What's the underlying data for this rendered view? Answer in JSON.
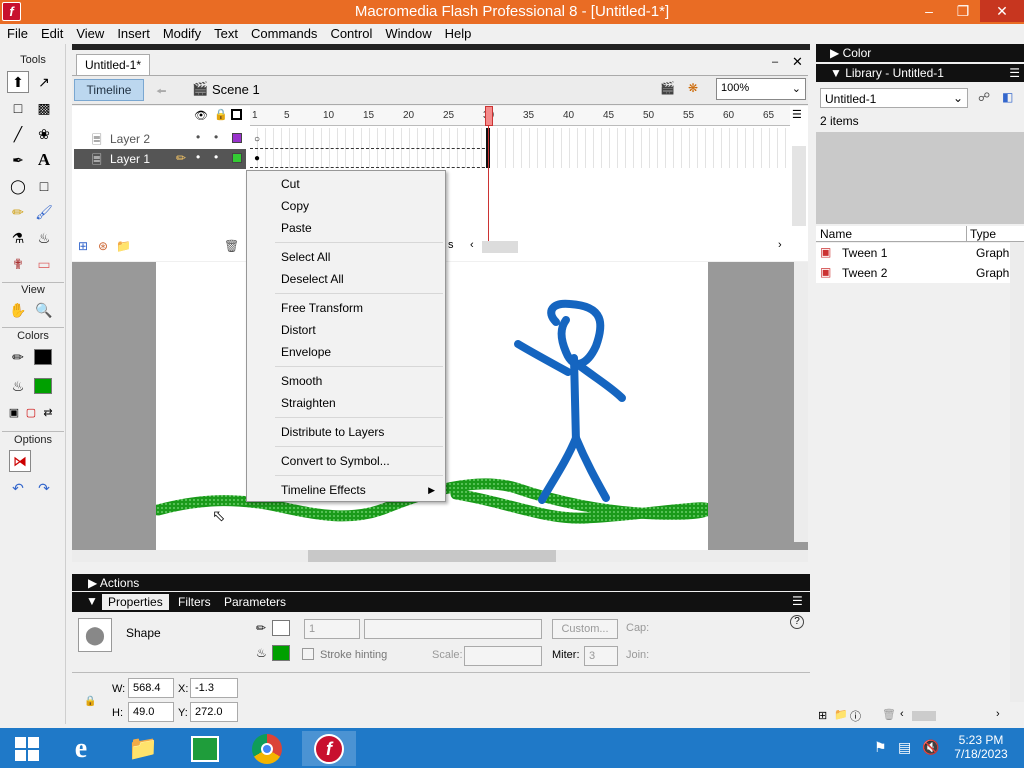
{
  "window": {
    "title": "Macromedia Flash Professional 8 - [Untitled-1*]"
  },
  "menu": [
    "File",
    "Edit",
    "View",
    "Insert",
    "Modify",
    "Text",
    "Commands",
    "Control",
    "Window",
    "Help"
  ],
  "tools": {
    "header": "Tools",
    "view": "View",
    "colors": "Colors",
    "options": "Options"
  },
  "document": {
    "tab": "Untitled-1*",
    "timeline_button": "Timeline",
    "scene": "Scene 1",
    "zoom": "100%"
  },
  "timeline": {
    "layers": [
      {
        "name": "Layer 2"
      },
      {
        "name": "Layer 1"
      }
    ],
    "ruler": [
      "1",
      "5",
      "10",
      "15",
      "20",
      "25",
      "30",
      "35",
      "40",
      "45",
      "50",
      "55",
      "60",
      "65"
    ],
    "current_frame": "30",
    "fps_fragment": "s"
  },
  "context_menu": {
    "items": [
      "Cut",
      "Copy",
      "Paste",
      "Select All",
      "Deselect All",
      "Free Transform",
      "Distort",
      "Envelope",
      "Smooth",
      "Straighten",
      "Distribute to Layers",
      "Convert to Symbol...",
      "Timeline Effects"
    ]
  },
  "actions_panel": {
    "title": "Actions"
  },
  "properties": {
    "tabs": [
      "Properties",
      "Filters",
      "Parameters"
    ],
    "shape_label": "Shape",
    "stroke_size": "1",
    "custom_button": "Custom...",
    "cap_label": "Cap:",
    "stroke_hinting": "Stroke hinting",
    "scale_label": "Scale:",
    "miter_label": "Miter:",
    "miter_value": "3",
    "join_label": "Join:",
    "w_label": "W:",
    "w_value": "568.4",
    "h_label": "H:",
    "h_value": "49.0",
    "x_label": "X:",
    "x_value": "-1.3",
    "y_label": "Y:",
    "y_value": "272.0",
    "stroke_color": "#000000",
    "fill_color": "#00a000"
  },
  "right_panel": {
    "color_title": "Color",
    "library_title": "Library - Untitled-1",
    "library_select": "Untitled-1",
    "item_count": "2 items",
    "col_name": "Name",
    "col_type": "Type",
    "items": [
      {
        "name": "Tween 1",
        "type": "Graph"
      },
      {
        "name": "Tween 2",
        "type": "Graph"
      }
    ]
  },
  "taskbar": {
    "time": "5:23 PM",
    "date": "7/18/2023"
  }
}
